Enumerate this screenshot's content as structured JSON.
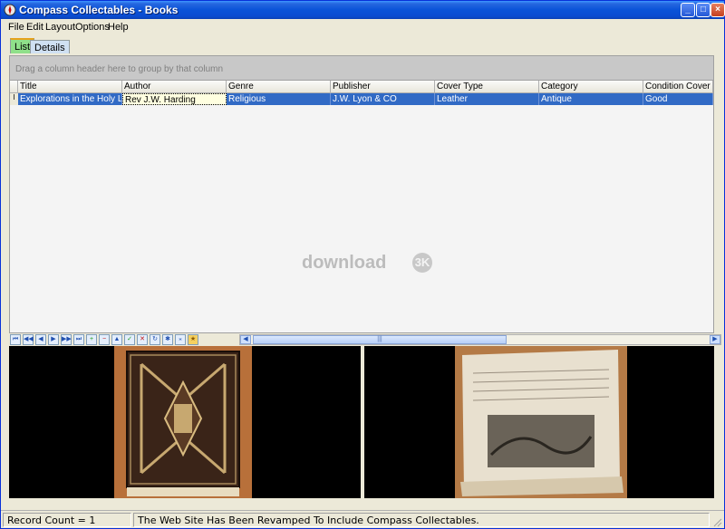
{
  "window": {
    "title": "Compass Collectables - Books",
    "min_glyph": "_",
    "max_glyph": "□",
    "close_glyph": "×"
  },
  "menu": {
    "items": [
      "File",
      "Edit",
      "Layout",
      "Options",
      "Help"
    ]
  },
  "tabs": {
    "list": "List",
    "details": "Details"
  },
  "group_panel": {
    "hint": "Drag a column header here to group by that column"
  },
  "grid": {
    "columns": [
      "Title",
      "Author",
      "Genre",
      "Publisher",
      "Cover Type",
      "Category",
      "Condition Cover"
    ],
    "rows": [
      {
        "indicator": "I",
        "cells": [
          "Explorations in the Holy Land",
          "Rev J.W. Harding",
          "Religious",
          "J.W. Lyon & CO",
          "Leather",
          "Antique",
          "Good"
        ]
      }
    ]
  },
  "watermark": {
    "text": "download",
    "badge": "3K"
  },
  "navigator": {
    "buttons": [
      "⏮",
      "◀◀",
      "◀",
      "▶",
      "▶▶",
      "⏭",
      "+",
      "−",
      "▲",
      "✓",
      "✕",
      "↻",
      "✱",
      "⁎",
      "★"
    ]
  },
  "scrollbar": {
    "left": "◀",
    "right": "▶",
    "thumb": "|||"
  },
  "status": {
    "record_count": "Record Count = 1",
    "message": "The Web Site Has Been Revamped To Include Compass Collectables."
  },
  "colors": {
    "selection": "#316ac5",
    "titlebar": "#0a53d8",
    "tab_active": "#8fe08a"
  }
}
